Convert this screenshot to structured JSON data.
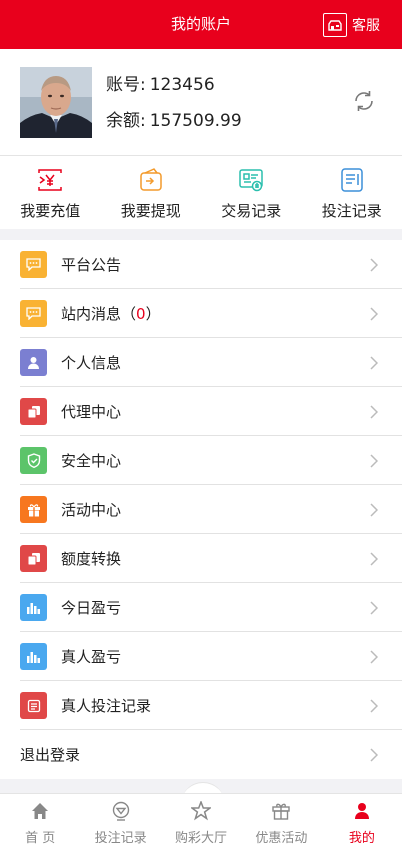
{
  "header": {
    "title": "我的账户",
    "service_label": "客服"
  },
  "profile": {
    "account_label": "账号:",
    "account_value": "123456",
    "balance_label": "余额:",
    "balance_value": "157509.99"
  },
  "actions": [
    {
      "label": "我要充值",
      "icon": "recharge-icon",
      "color": "#e8001c"
    },
    {
      "label": "我要提现",
      "icon": "withdraw-icon",
      "color": "#f39a2b"
    },
    {
      "label": "交易记录",
      "icon": "transaction-record-icon",
      "color": "#2bbfae"
    },
    {
      "label": "投注记录",
      "icon": "bet-record-icon",
      "color": "#3b8fd9"
    }
  ],
  "menu": {
    "items": [
      {
        "label": "平台公告",
        "icon": "announcement-icon",
        "color": "#f9b233"
      },
      {
        "label": "站内消息",
        "paren_open": "（",
        "count": "0",
        "paren_close": "）",
        "icon": "message-icon",
        "color": "#f9b233"
      },
      {
        "label": "个人信息",
        "icon": "user-icon",
        "color": "#7b7fd1"
      },
      {
        "label": "代理中心",
        "icon": "agent-icon",
        "color": "#e04848"
      },
      {
        "label": "安全中心",
        "icon": "shield-icon",
        "color": "#5cc46a"
      },
      {
        "label": "活动中心",
        "icon": "gift-icon",
        "color": "#f7771f"
      },
      {
        "label": "额度转换",
        "icon": "transfer-icon",
        "color": "#e04848"
      },
      {
        "label": "今日盈亏",
        "icon": "bar-chart-icon",
        "color": "#4aa8ef"
      },
      {
        "label": "真人盈亏",
        "icon": "bar-chart-icon",
        "color": "#4aa8ef"
      },
      {
        "label": "真人投注记录",
        "icon": "record-icon",
        "color": "#e04848"
      },
      {
        "label": "退出登录"
      }
    ]
  },
  "tabbar": [
    {
      "label": "首 页",
      "icon": "home-icon"
    },
    {
      "label": "投注记录",
      "icon": "bet-record-icon"
    },
    {
      "label": "购彩大厅",
      "icon": "lottery-hall-icon"
    },
    {
      "label": "优惠活动",
      "icon": "gift-icon"
    },
    {
      "label": "我的",
      "icon": "user-icon",
      "active": true,
      "color": "#e8001c"
    }
  ]
}
